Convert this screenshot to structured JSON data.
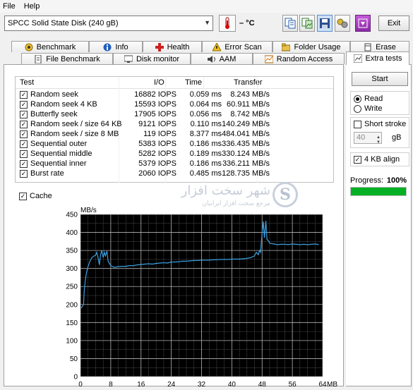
{
  "menu": {
    "file": "File",
    "help": "Help"
  },
  "toolbar": {
    "disk": "SPCC Solid State Disk (240 gB)",
    "temperature": "– °C",
    "exit": "Exit"
  },
  "tabs_row1": [
    "Benchmark",
    "Info",
    "Health",
    "Error Scan",
    "Folder Usage",
    "Erase"
  ],
  "tabs_row2": [
    "File Benchmark",
    "Disk monitor",
    "AAM",
    "Random Access",
    "Extra tests"
  ],
  "results": {
    "headers": {
      "test": "Test",
      "io": "I/O",
      "time": "Time",
      "transfer": "Transfer"
    },
    "rows": [
      {
        "test": "Random seek",
        "io": "16882 IOPS",
        "time": "0.059 ms",
        "transfer": "8.243 MB/s"
      },
      {
        "test": "Random seek 4 KB",
        "io": "15593 IOPS",
        "time": "0.064 ms",
        "transfer": "60.911 MB/s"
      },
      {
        "test": "Butterfly seek",
        "io": "17905 IOPS",
        "time": "0.056 ms",
        "transfer": "8.742 MB/s"
      },
      {
        "test": "Random seek / size 64 KB",
        "io": "9121 IOPS",
        "time": "0.110 ms",
        "transfer": "140.249 MB/s"
      },
      {
        "test": "Random seek / size 8 MB",
        "io": "119 IOPS",
        "time": "8.377 ms",
        "transfer": "484.041 MB/s"
      },
      {
        "test": "Sequential outer",
        "io": "5383 IOPS",
        "time": "0.186 ms",
        "transfer": "336.435 MB/s"
      },
      {
        "test": "Sequential middle",
        "io": "5282 IOPS",
        "time": "0.189 ms",
        "transfer": "330.124 MB/s"
      },
      {
        "test": "Sequential inner",
        "io": "5379 IOPS",
        "time": "0.186 ms",
        "transfer": "336.211 MB/s"
      },
      {
        "test": "Burst rate",
        "io": "2060 IOPS",
        "time": "0.485 ms",
        "transfer": "128.735 MB/s"
      }
    ]
  },
  "cache": {
    "label": "Cache",
    "checked": true
  },
  "watermark": {
    "line1": "شهر سخت افزار",
    "line2": "مرجع سخت افزار ایرانیان",
    "logo": "S"
  },
  "side": {
    "start": "Start",
    "read": "Read",
    "write": "Write",
    "short_stroke": "Short stroke",
    "gb_value": "40",
    "gb_unit": "gB",
    "align": "4 KB align",
    "progress_label": "Progress:",
    "progress_value": "100%",
    "progress_fraction": 1.0
  },
  "colors": {
    "line": "#3aa0e0",
    "plot_bg": "#000000",
    "grid": "#b4b4b4",
    "progress": "#06b025"
  },
  "chart_data": {
    "type": "line",
    "xlabel": "MB",
    "ylabel": "MB/s",
    "xlim": [
      0,
      64
    ],
    "ylim": [
      0,
      450
    ],
    "x_ticks": [
      0,
      8,
      16,
      24,
      32,
      40,
      48,
      56,
      64
    ],
    "y_ticks": [
      0,
      50,
      100,
      150,
      200,
      250,
      300,
      350,
      400,
      450
    ],
    "grid": true,
    "series": [
      {
        "x": [
          0.2,
          0.5,
          0.8,
          1.0,
          1.3,
          1.6,
          2,
          2.5,
          3,
          3.5,
          4,
          4.3,
          4.6,
          5,
          5.3,
          5.6,
          6,
          6.3,
          6.6,
          7,
          7.3,
          7.6,
          8,
          8.5,
          9,
          10,
          11,
          12,
          13,
          14,
          15,
          16,
          17,
          18,
          19,
          20,
          21,
          22,
          23,
          24,
          25,
          26,
          27,
          28,
          29,
          30,
          31,
          32,
          33,
          34,
          35,
          36,
          37,
          38,
          39,
          40,
          41,
          42,
          43,
          44,
          45,
          46,
          46.5,
          47,
          47.3,
          47.6,
          48,
          48.3,
          48.6,
          49,
          49.3,
          49.6,
          50,
          51,
          52,
          53,
          54,
          55,
          56,
          57,
          58,
          59,
          60,
          61,
          62,
          63
        ],
        "y": [
          190,
          195,
          200,
          240,
          270,
          290,
          305,
          320,
          330,
          334,
          337,
          345,
          332,
          310,
          338,
          350,
          330,
          345,
          335,
          348,
          320,
          315,
          308,
          305,
          303,
          305,
          306,
          306,
          308,
          308,
          310,
          311,
          312,
          313,
          312,
          314,
          315,
          316,
          315,
          318,
          318,
          319,
          320,
          320,
          321,
          322,
          322,
          323,
          323,
          323,
          324,
          324,
          325,
          325,
          325,
          326,
          326,
          326,
          327,
          328,
          330,
          335,
          345,
          338,
          350,
          345,
          400,
          430,
          385,
          432,
          380,
          378,
          370,
          368,
          366,
          367,
          367,
          366,
          368,
          367,
          366,
          367,
          366,
          367,
          368,
          366
        ]
      }
    ]
  }
}
